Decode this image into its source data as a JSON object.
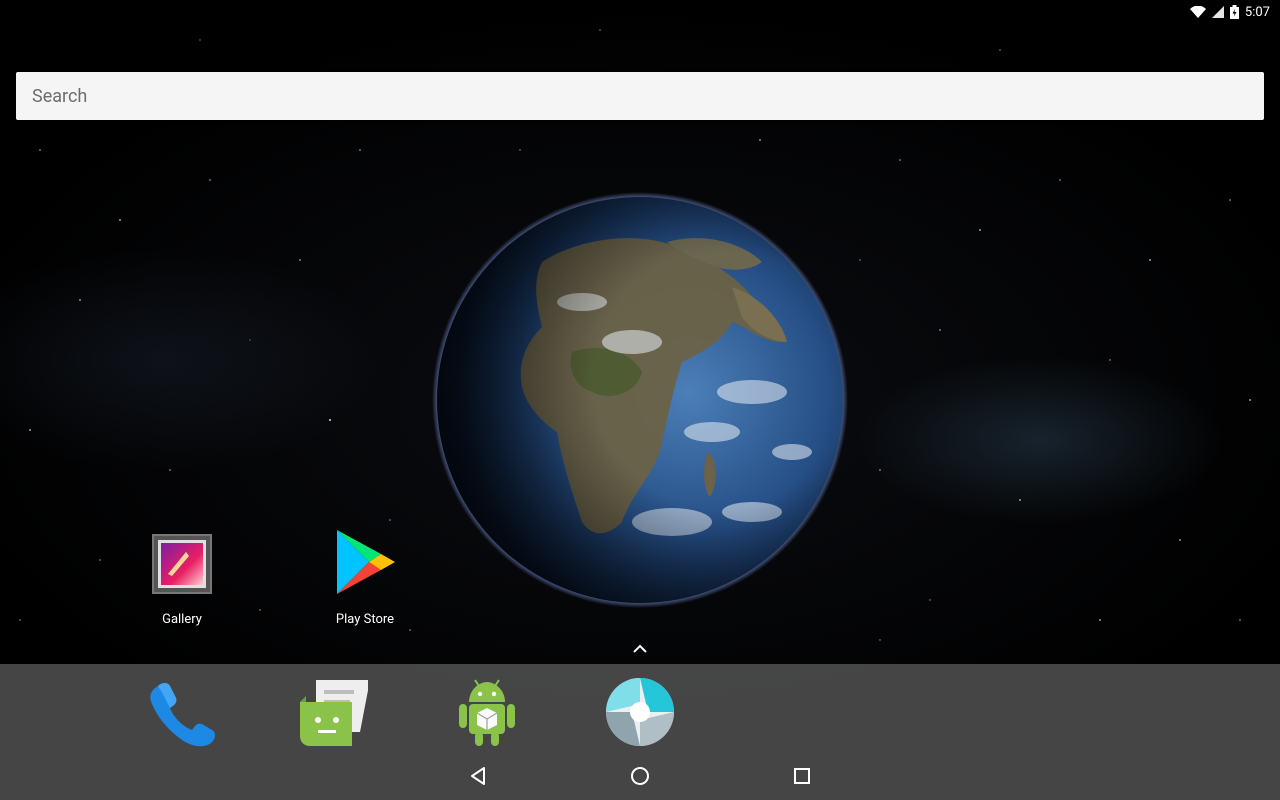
{
  "status_bar": {
    "time": "5:07",
    "icons": [
      "wifi-icon",
      "cell-signal-icon",
      "battery-icon"
    ]
  },
  "search": {
    "placeholder": "Search"
  },
  "wallpaper": {
    "icon": "earth-live-wallpaper"
  },
  "desktop_apps": [
    {
      "label": "Gallery",
      "icon": "gallery-icon"
    },
    {
      "label": "Play Store",
      "icon": "play-store-icon"
    }
  ],
  "dock_apps": [
    {
      "icon": "phone-icon"
    },
    {
      "icon": "messaging-icon"
    },
    {
      "icon": "android-app-icon"
    },
    {
      "icon": "camera-icon"
    }
  ],
  "nav_buttons": [
    {
      "icon": "back-icon"
    },
    {
      "icon": "home-icon"
    },
    {
      "icon": "recents-icon"
    }
  ],
  "colors": {
    "search_bg": "#f5f5f5",
    "dock_bg": "#5f5f5f",
    "phone_blue": "#1e88e5",
    "messaging_green": "#8bc34a",
    "android_green": "#8bc34a",
    "camera_cyan": "#26c6da"
  }
}
